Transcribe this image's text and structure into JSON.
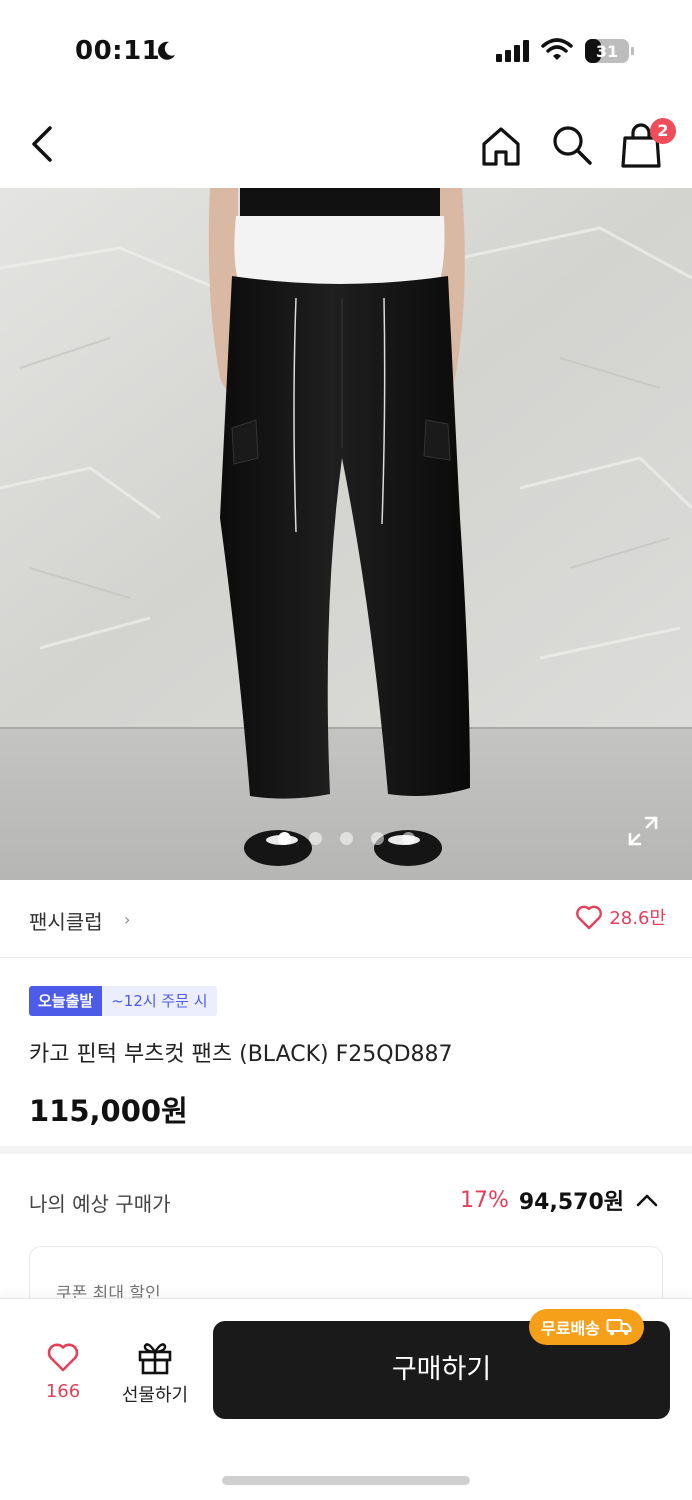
{
  "status_bar": {
    "time": "00:11",
    "battery": "31"
  },
  "nav": {
    "cart_count": "2"
  },
  "gallery": {
    "total": 5,
    "active": 0
  },
  "brand": {
    "name": "팬시클럽",
    "arrow": "›",
    "likes": "28.6만"
  },
  "product": {
    "tag_today": "오늘출발",
    "tag_time": "~12시 주문 시",
    "title": "카고 핀턱 부츠컷 팬츠 (BLACK) F25QD887",
    "price": "115,000원"
  },
  "expected_price": {
    "label": "나의 예상 구매가",
    "discount": "17%",
    "amount": "94,570원"
  },
  "coupon": {
    "label": "쿠폰 최대 할인"
  },
  "bottom_bar": {
    "wish_count": "166",
    "gift_label": "선물하기",
    "buy_label": "구매하기",
    "free_shipping": "무료배송"
  },
  "colors": {
    "accent": "#e4405a",
    "blue": "#4d5ce8",
    "orange": "#f6a01a"
  }
}
